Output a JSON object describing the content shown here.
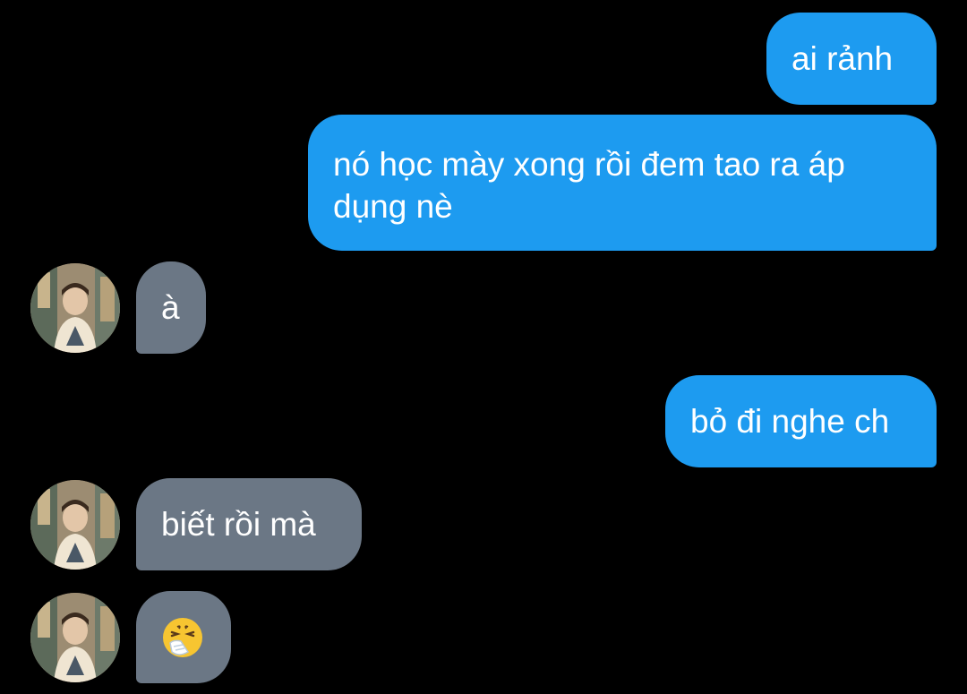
{
  "conversation": {
    "messages": [
      {
        "direction": "outgoing",
        "text": "ai rảnh"
      },
      {
        "direction": "outgoing",
        "text": "nó học mày xong rồi đem tao ra áp dụng nè"
      },
      {
        "direction": "incoming",
        "text": "à"
      },
      {
        "direction": "outgoing",
        "text": "bỏ đi nghe ch"
      },
      {
        "direction": "incoming",
        "text": "biết rồi mà"
      },
      {
        "direction": "incoming",
        "emoji": "sneezing-face",
        "text": "🤧"
      }
    ]
  },
  "colors": {
    "background": "#000000",
    "outgoing_bubble": "#1d9bf0",
    "incoming_bubble": "#6b7785",
    "text": "#ffffff"
  },
  "icons": {
    "avatar": "contact-avatar-photo"
  }
}
